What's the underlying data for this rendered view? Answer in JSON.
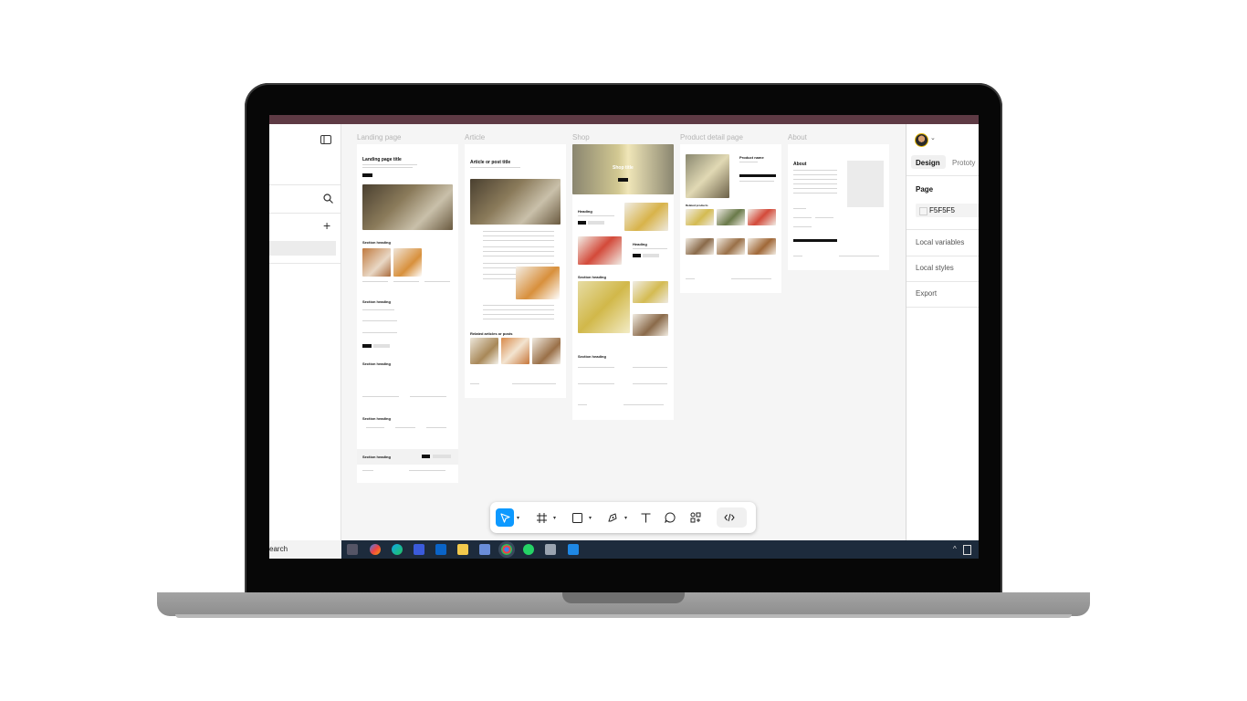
{
  "frames": {
    "landing": {
      "label": "Landing page",
      "title": "Landing page title",
      "section_heading": "Section heading",
      "button_primary": "",
      "button_secondary": ""
    },
    "article": {
      "label": "Article",
      "title": "Article or post title",
      "related": "Related articles or posts"
    },
    "shop": {
      "label": "Shop",
      "hero_title": "Shop title",
      "heading": "Heading",
      "section_heading": "Section heading"
    },
    "product": {
      "label": "Product detail page",
      "product_name": "Product name",
      "related_label": "Related products"
    },
    "about": {
      "label": "About",
      "title": "About"
    }
  },
  "left_panel": {
    "search_icon": "search-icon",
    "add_icon": "plus-icon",
    "panel_icon": "panel-toggle-icon"
  },
  "right_panel": {
    "tabs": {
      "design": "Design",
      "prototype": "Prototy"
    },
    "page_label": "Page",
    "page_color": "F5F5F5",
    "local_variables": "Local variables",
    "local_styles": "Local styles",
    "export": "Export"
  },
  "toolbar": {
    "tools": [
      "move-tool",
      "frame-tool",
      "shape-tool",
      "pen-tool",
      "text-tool",
      "comment-tool",
      "actions-tool",
      "dev-mode-toggle"
    ]
  },
  "taskbar": {
    "search_label": "earch"
  },
  "colors": {
    "accent": "#0d99ff",
    "canvas": "#f5f5f5",
    "taskbar": "#1d2b3c"
  }
}
